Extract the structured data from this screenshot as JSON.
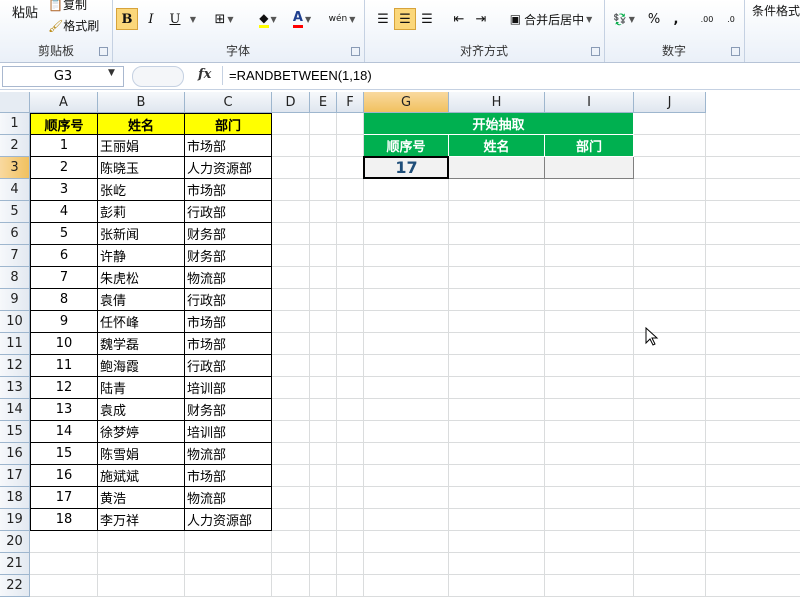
{
  "ribbon": {
    "clipboard": {
      "paste": "粘贴",
      "copy": "复制",
      "format_painter": "格式刷",
      "label": "剪贴板"
    },
    "font": {
      "bold": "B",
      "italic": "I",
      "underline": "U",
      "border": "⊞",
      "fill": "A",
      "font_color": "A",
      "wen": "wén",
      "label": "字体"
    },
    "alignment": {
      "merge_center": "合并后居中",
      "label": "对齐方式"
    },
    "number": {
      "percent": "%",
      "comma": ",",
      "label": "数字"
    },
    "styles": {
      "conditional": "条件格式"
    }
  },
  "formula_bar": {
    "name_box": "G3",
    "fx": "fx",
    "formula": "=RANDBETWEEN(1,18)"
  },
  "columns": [
    "A",
    "B",
    "C",
    "D",
    "E",
    "F",
    "G",
    "H",
    "I",
    "J"
  ],
  "rows": [
    "1",
    "2",
    "3",
    "4",
    "5",
    "6",
    "7",
    "8",
    "9",
    "10",
    "11",
    "12",
    "13",
    "14",
    "15",
    "16",
    "17",
    "18",
    "19",
    "20",
    "21",
    "22"
  ],
  "table": {
    "headers": [
      "顺序号",
      "姓名",
      "部门"
    ],
    "records": [
      [
        "1",
        "王丽娟",
        "市场部"
      ],
      [
        "2",
        "陈晓玉",
        "人力资源部"
      ],
      [
        "3",
        "张屹",
        "市场部"
      ],
      [
        "4",
        "彭莉",
        "行政部"
      ],
      [
        "5",
        "张新闻",
        "财务部"
      ],
      [
        "6",
        "许静",
        "财务部"
      ],
      [
        "7",
        "朱虎松",
        "物流部"
      ],
      [
        "8",
        "袁倩",
        "行政部"
      ],
      [
        "9",
        "任怀峰",
        "市场部"
      ],
      [
        "10",
        "魏学磊",
        "市场部"
      ],
      [
        "11",
        "鲍海霞",
        "行政部"
      ],
      [
        "12",
        "陆青",
        "培训部"
      ],
      [
        "13",
        "袁成",
        "财务部"
      ],
      [
        "14",
        "徐梦婷",
        "培训部"
      ],
      [
        "15",
        "陈雪娟",
        "物流部"
      ],
      [
        "16",
        "施斌斌",
        "市场部"
      ],
      [
        "17",
        "黄浩",
        "物流部"
      ],
      [
        "18",
        "李万祥",
        "人力资源部"
      ]
    ]
  },
  "draw": {
    "title": "开始抽取",
    "headers": [
      "顺序号",
      "姓名",
      "部门"
    ],
    "result": [
      "17",
      "",
      ""
    ]
  },
  "colors": {
    "header_yellow": "#ffff00",
    "draw_green": "#00b050",
    "result_blue": "#1f4e79"
  }
}
